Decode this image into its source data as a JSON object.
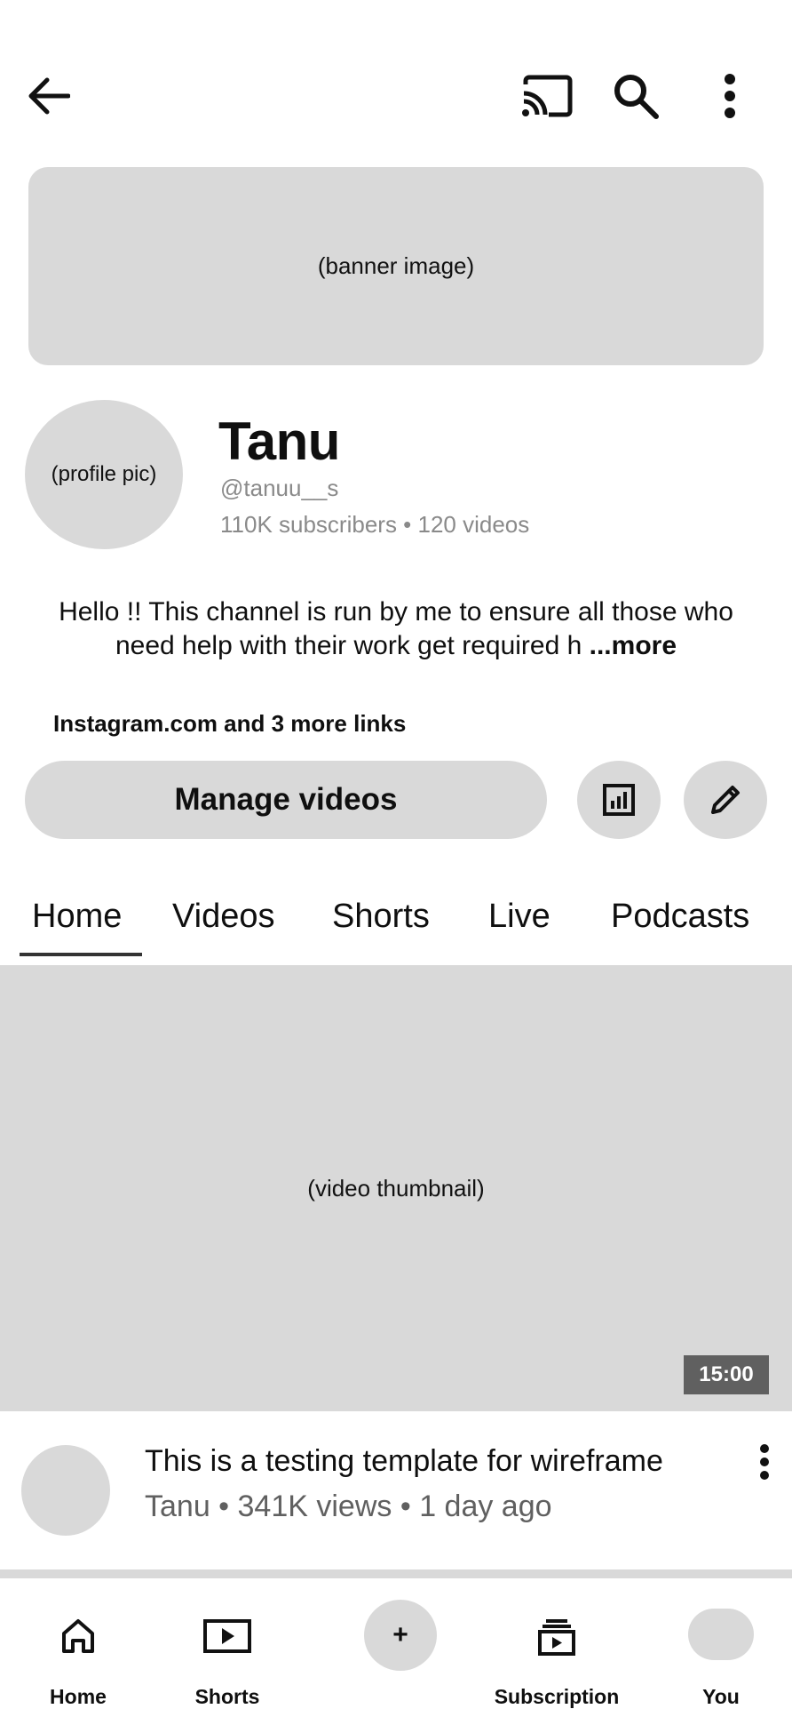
{
  "header": {
    "icons": [
      "back-arrow-icon",
      "cast-icon",
      "search-icon",
      "more-vert-icon"
    ]
  },
  "banner": {
    "placeholder": "(banner image)"
  },
  "channel": {
    "avatar_placeholder": "(profile pic)",
    "name": "Tanu",
    "handle": "@tanuu__s",
    "stats": "110K subscribers • 120 videos",
    "description": "Hello !! This channel is run by me to ensure all those who need help with their work get required h",
    "description_more": "...more",
    "links": "Instagram.com and 3 more links"
  },
  "actions": {
    "manage_label": "Manage videos",
    "icons": [
      "analytics-icon",
      "edit-pencil-icon"
    ]
  },
  "tabs": [
    {
      "label": "Home",
      "active": true
    },
    {
      "label": "Videos",
      "active": false
    },
    {
      "label": "Shorts",
      "active": false
    },
    {
      "label": "Live",
      "active": false
    },
    {
      "label": "Podcasts",
      "active": false
    }
  ],
  "video": {
    "thumbnail_placeholder": "(video thumbnail)",
    "duration": "15:00",
    "title": "This is a testing template for wireframe",
    "meta": "Tanu • 341K views • 1 day ago"
  },
  "bottom_nav": {
    "home": "Home",
    "shorts": "Shorts",
    "create": "+",
    "subscription": "Subscription",
    "you": "You"
  },
  "colors": {
    "placeholder_gray": "#d9d9d9",
    "text": "#0f0f0f",
    "muted": "#8a8a8a"
  }
}
